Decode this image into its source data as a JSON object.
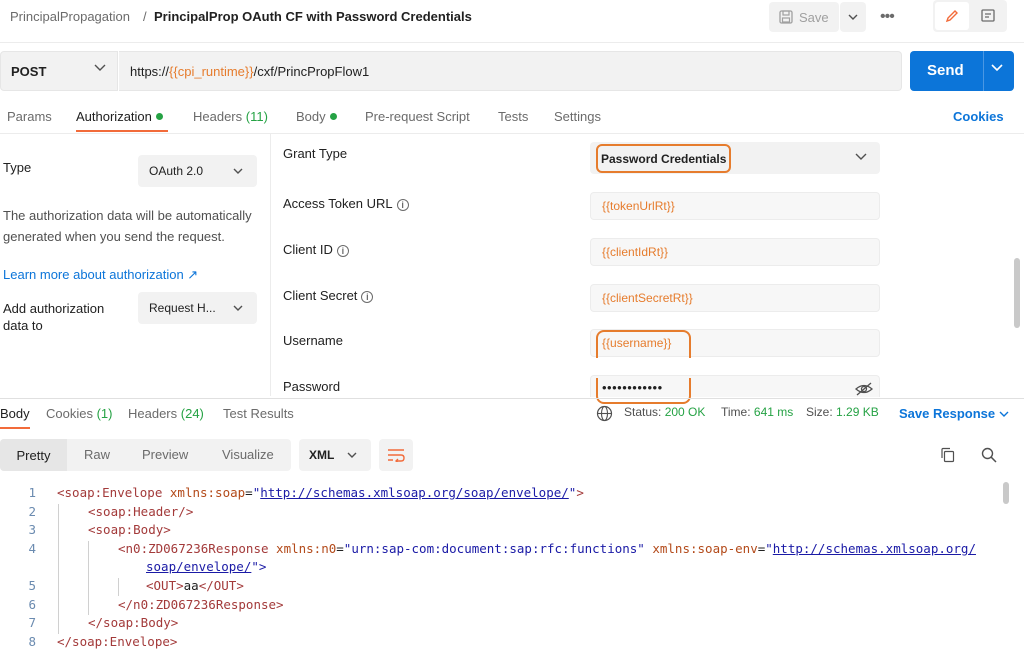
{
  "header": {
    "breadcrumb_parent": "PrincipalPropagation",
    "breadcrumb_sep": "/",
    "title": "PrincipalProp OAuth CF with Password Credentials",
    "save_label": "Save"
  },
  "request": {
    "method": "POST",
    "url_prefix": "https://",
    "url_var": "{{cpi_runtime}}",
    "url_suffix": "/cxf/PrincPropFlow1",
    "send_label": "Send"
  },
  "request_tabs": {
    "params": "Params",
    "authorization": "Authorization",
    "headers": "Headers",
    "headers_count": "(11)",
    "body": "Body",
    "prerequest": "Pre-request Script",
    "tests": "Tests",
    "settings": "Settings",
    "cookies": "Cookies"
  },
  "auth": {
    "type_label": "Type",
    "type_value": "OAuth 2.0",
    "description": "The authorization data will be automatically generated when you send the request.",
    "learn_more": "Learn more about authorization ↗",
    "add_to_label": "Add authorization data to",
    "add_to_value": "Request H...",
    "fields": {
      "grant_type_label": "Grant Type",
      "grant_type_value": "Password Credentials",
      "token_url_label": "Access Token URL",
      "token_url_value": "{{tokenUrlRt}}",
      "client_id_label": "Client ID",
      "client_id_value": "{{clientIdRt}}",
      "client_secret_label": "Client Secret",
      "client_secret_value": "{{clientSecretRt}}",
      "username_label": "Username",
      "username_value": "{{username}}",
      "password_label": "Password",
      "password_value": "••••••••••••"
    }
  },
  "response": {
    "tabs": {
      "body": "Body",
      "cookies": "Cookies",
      "cookies_count": "(1)",
      "headers": "Headers",
      "headers_count": "(24)",
      "test_results": "Test Results"
    },
    "status_label": "Status:",
    "status_value": "200 OK",
    "time_label": "Time:",
    "time_value": "641 ms",
    "size_label": "Size:",
    "size_value": "1.29 KB",
    "save_response": "Save Response",
    "formats": {
      "pretty": "Pretty",
      "raw": "Raw",
      "preview": "Preview",
      "visualize": "Visualize",
      "language": "XML"
    },
    "code": {
      "l1_open": "<soap:Envelope",
      "l1_attr": "xmlns:soap",
      "l1_val_q": "\"",
      "l1_link": "http://schemas.xmlsoap.org/soap/envelope/",
      "l1_close": ">",
      "l2": "<soap:Header/>",
      "l3": "<soap:Body>",
      "l4_open": "<n0:ZD067236Response",
      "l4_attr1": "xmlns:n0",
      "l4_val1": "\"urn:sap-com:document:sap:rfc:functions\"",
      "l4_attr2": "xmlns:soap-env",
      "l4_link_a": "http://schemas.xmlsoap.org/",
      "l4_link_b": "soap/envelope/",
      "l4_end": "\">",
      "l5_open": "<OUT>",
      "l5_text": "aa",
      "l5_close": "</OUT>",
      "l6": "</n0:ZD067236Response>",
      "l7": "</soap:Body>",
      "l8": "</soap:Envelope>"
    },
    "line_numbers": [
      "1",
      "2",
      "3",
      "4",
      "5",
      "6",
      "7",
      "8"
    ]
  }
}
